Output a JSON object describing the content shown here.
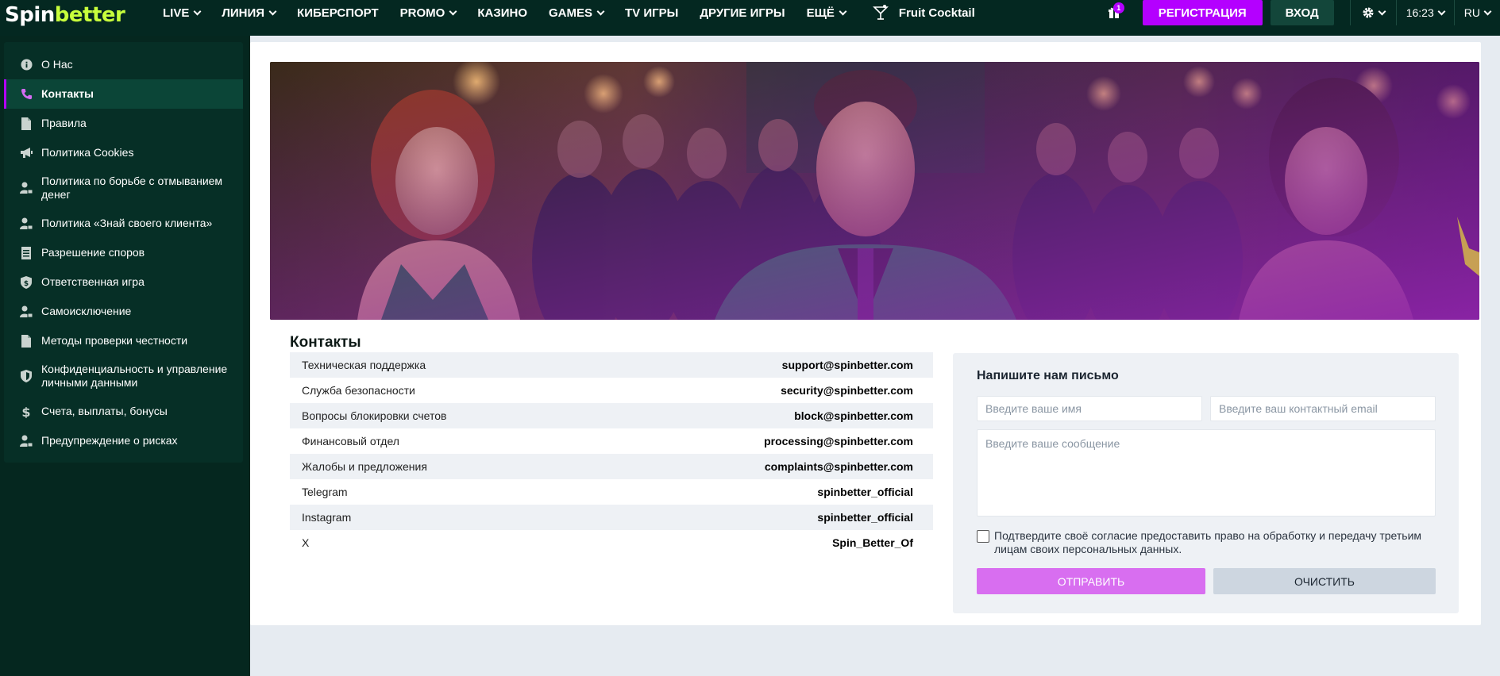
{
  "header": {
    "logo": {
      "part1": "Spin",
      "part2": "better"
    },
    "nav": [
      {
        "label": "LIVE",
        "dropdown": true
      },
      {
        "label": "ЛИНИЯ",
        "dropdown": true
      },
      {
        "label": "КИБЕРСПОРТ",
        "dropdown": false
      },
      {
        "label": "PROMO",
        "dropdown": true
      },
      {
        "label": "КАЗИНО",
        "dropdown": false
      },
      {
        "label": "GAMES",
        "dropdown": true
      },
      {
        "label": "TV ИГРЫ",
        "dropdown": false
      },
      {
        "label": "ДРУГИЕ ИГРЫ",
        "dropdown": false
      },
      {
        "label": "ЕЩЁ",
        "dropdown": true
      }
    ],
    "featured_game": "Fruit Cocktail",
    "gift_count": "1",
    "register_label": "РЕГИСТРАЦИЯ",
    "login_label": "ВХОД",
    "time": "16:23",
    "language": "RU",
    "colors": {
      "bg": "#042821",
      "accent": "#b400ff",
      "logo_green": "#c8ff3c"
    }
  },
  "sidebar": {
    "items": [
      {
        "label": "О Нас",
        "icon": "info-icon",
        "active": false
      },
      {
        "label": "Контакты",
        "icon": "phone-icon",
        "active": true
      },
      {
        "label": "Правила",
        "icon": "document-icon",
        "active": false
      },
      {
        "label": "Политика Cookies",
        "icon": "megaphone-icon",
        "active": false
      },
      {
        "label": "Политика по борьбе с отмыванием денег",
        "icon": "user-lock-icon",
        "active": false
      },
      {
        "label": "Политика «Знай своего клиента»",
        "icon": "user-lock-icon",
        "active": false
      },
      {
        "label": "Разрешение споров",
        "icon": "list-document-icon",
        "active": false
      },
      {
        "label": "Ответственная игра",
        "icon": "shield-dollar-icon",
        "active": false
      },
      {
        "label": "Самоисключение",
        "icon": "user-lock-icon",
        "active": false
      },
      {
        "label": "Методы проверки честности",
        "icon": "document-icon",
        "active": false
      },
      {
        "label": "Конфиденциальность и управление личными данными",
        "icon": "shield-icon",
        "active": false
      },
      {
        "label": "Счета, выплаты, бонусы",
        "icon": "dollar-icon",
        "active": false
      },
      {
        "label": "Предупреждение о рисках",
        "icon": "user-lock-icon",
        "active": false
      }
    ]
  },
  "contacts": {
    "title": "Контакты",
    "rows": [
      {
        "label": "Техническая поддержка",
        "value": "support@spinbetter.com"
      },
      {
        "label": "Служба безопасности",
        "value": "security@spinbetter.com"
      },
      {
        "label": "Вопросы блокировки счетов",
        "value": "block@spinbetter.com"
      },
      {
        "label": "Финансовый отдел",
        "value": "processing@spinbetter.com"
      },
      {
        "label": "Жалобы и предложения",
        "value": "complaints@spinbetter.com"
      },
      {
        "label": "Telegram",
        "value": "spinbetter_official"
      },
      {
        "label": "Instagram",
        "value": "spinbetter_official"
      },
      {
        "label": "X",
        "value": "Spin_Better_Of"
      }
    ]
  },
  "form": {
    "title": "Напишите нам письмо",
    "name_placeholder": "Введите ваше имя",
    "email_placeholder": "Введите ваш контактный email",
    "message_placeholder": "Введите ваше сообщение",
    "consent_text": "Подтвердите своё согласие предоставить право на обработку и передачу третьим лицам своих персональных данных.",
    "consent_checked": false,
    "send_label": "ОТПРАВИТЬ",
    "clear_label": "ОЧИСТИТЬ"
  }
}
